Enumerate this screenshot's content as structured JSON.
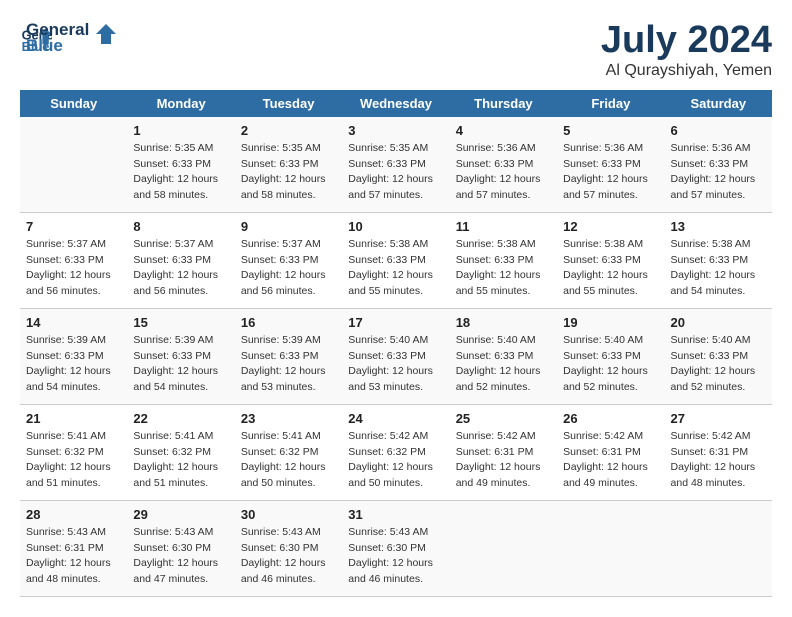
{
  "header": {
    "logo_line1": "General",
    "logo_line2": "Blue",
    "month_year": "July 2024",
    "location": "Al Qurayshiyah, Yemen"
  },
  "weekdays": [
    "Sunday",
    "Monday",
    "Tuesday",
    "Wednesday",
    "Thursday",
    "Friday",
    "Saturday"
  ],
  "weeks": [
    [
      {
        "day": "",
        "sunrise": "",
        "sunset": "",
        "daylight": ""
      },
      {
        "day": "1",
        "sunrise": "Sunrise: 5:35 AM",
        "sunset": "Sunset: 6:33 PM",
        "daylight": "Daylight: 12 hours and 58 minutes."
      },
      {
        "day": "2",
        "sunrise": "Sunrise: 5:35 AM",
        "sunset": "Sunset: 6:33 PM",
        "daylight": "Daylight: 12 hours and 58 minutes."
      },
      {
        "day": "3",
        "sunrise": "Sunrise: 5:35 AM",
        "sunset": "Sunset: 6:33 PM",
        "daylight": "Daylight: 12 hours and 57 minutes."
      },
      {
        "day": "4",
        "sunrise": "Sunrise: 5:36 AM",
        "sunset": "Sunset: 6:33 PM",
        "daylight": "Daylight: 12 hours and 57 minutes."
      },
      {
        "day": "5",
        "sunrise": "Sunrise: 5:36 AM",
        "sunset": "Sunset: 6:33 PM",
        "daylight": "Daylight: 12 hours and 57 minutes."
      },
      {
        "day": "6",
        "sunrise": "Sunrise: 5:36 AM",
        "sunset": "Sunset: 6:33 PM",
        "daylight": "Daylight: 12 hours and 57 minutes."
      }
    ],
    [
      {
        "day": "7",
        "sunrise": "Sunrise: 5:37 AM",
        "sunset": "Sunset: 6:33 PM",
        "daylight": "Daylight: 12 hours and 56 minutes."
      },
      {
        "day": "8",
        "sunrise": "Sunrise: 5:37 AM",
        "sunset": "Sunset: 6:33 PM",
        "daylight": "Daylight: 12 hours and 56 minutes."
      },
      {
        "day": "9",
        "sunrise": "Sunrise: 5:37 AM",
        "sunset": "Sunset: 6:33 PM",
        "daylight": "Daylight: 12 hours and 56 minutes."
      },
      {
        "day": "10",
        "sunrise": "Sunrise: 5:38 AM",
        "sunset": "Sunset: 6:33 PM",
        "daylight": "Daylight: 12 hours and 55 minutes."
      },
      {
        "day": "11",
        "sunrise": "Sunrise: 5:38 AM",
        "sunset": "Sunset: 6:33 PM",
        "daylight": "Daylight: 12 hours and 55 minutes."
      },
      {
        "day": "12",
        "sunrise": "Sunrise: 5:38 AM",
        "sunset": "Sunset: 6:33 PM",
        "daylight": "Daylight: 12 hours and 55 minutes."
      },
      {
        "day": "13",
        "sunrise": "Sunrise: 5:38 AM",
        "sunset": "Sunset: 6:33 PM",
        "daylight": "Daylight: 12 hours and 54 minutes."
      }
    ],
    [
      {
        "day": "14",
        "sunrise": "Sunrise: 5:39 AM",
        "sunset": "Sunset: 6:33 PM",
        "daylight": "Daylight: 12 hours and 54 minutes."
      },
      {
        "day": "15",
        "sunrise": "Sunrise: 5:39 AM",
        "sunset": "Sunset: 6:33 PM",
        "daylight": "Daylight: 12 hours and 54 minutes."
      },
      {
        "day": "16",
        "sunrise": "Sunrise: 5:39 AM",
        "sunset": "Sunset: 6:33 PM",
        "daylight": "Daylight: 12 hours and 53 minutes."
      },
      {
        "day": "17",
        "sunrise": "Sunrise: 5:40 AM",
        "sunset": "Sunset: 6:33 PM",
        "daylight": "Daylight: 12 hours and 53 minutes."
      },
      {
        "day": "18",
        "sunrise": "Sunrise: 5:40 AM",
        "sunset": "Sunset: 6:33 PM",
        "daylight": "Daylight: 12 hours and 52 minutes."
      },
      {
        "day": "19",
        "sunrise": "Sunrise: 5:40 AM",
        "sunset": "Sunset: 6:33 PM",
        "daylight": "Daylight: 12 hours and 52 minutes."
      },
      {
        "day": "20",
        "sunrise": "Sunrise: 5:40 AM",
        "sunset": "Sunset: 6:33 PM",
        "daylight": "Daylight: 12 hours and 52 minutes."
      }
    ],
    [
      {
        "day": "21",
        "sunrise": "Sunrise: 5:41 AM",
        "sunset": "Sunset: 6:32 PM",
        "daylight": "Daylight: 12 hours and 51 minutes."
      },
      {
        "day": "22",
        "sunrise": "Sunrise: 5:41 AM",
        "sunset": "Sunset: 6:32 PM",
        "daylight": "Daylight: 12 hours and 51 minutes."
      },
      {
        "day": "23",
        "sunrise": "Sunrise: 5:41 AM",
        "sunset": "Sunset: 6:32 PM",
        "daylight": "Daylight: 12 hours and 50 minutes."
      },
      {
        "day": "24",
        "sunrise": "Sunrise: 5:42 AM",
        "sunset": "Sunset: 6:32 PM",
        "daylight": "Daylight: 12 hours and 50 minutes."
      },
      {
        "day": "25",
        "sunrise": "Sunrise: 5:42 AM",
        "sunset": "Sunset: 6:31 PM",
        "daylight": "Daylight: 12 hours and 49 minutes."
      },
      {
        "day": "26",
        "sunrise": "Sunrise: 5:42 AM",
        "sunset": "Sunset: 6:31 PM",
        "daylight": "Daylight: 12 hours and 49 minutes."
      },
      {
        "day": "27",
        "sunrise": "Sunrise: 5:42 AM",
        "sunset": "Sunset: 6:31 PM",
        "daylight": "Daylight: 12 hours and 48 minutes."
      }
    ],
    [
      {
        "day": "28",
        "sunrise": "Sunrise: 5:43 AM",
        "sunset": "Sunset: 6:31 PM",
        "daylight": "Daylight: 12 hours and 48 minutes."
      },
      {
        "day": "29",
        "sunrise": "Sunrise: 5:43 AM",
        "sunset": "Sunset: 6:30 PM",
        "daylight": "Daylight: 12 hours and 47 minutes."
      },
      {
        "day": "30",
        "sunrise": "Sunrise: 5:43 AM",
        "sunset": "Sunset: 6:30 PM",
        "daylight": "Daylight: 12 hours and 46 minutes."
      },
      {
        "day": "31",
        "sunrise": "Sunrise: 5:43 AM",
        "sunset": "Sunset: 6:30 PM",
        "daylight": "Daylight: 12 hours and 46 minutes."
      },
      {
        "day": "",
        "sunrise": "",
        "sunset": "",
        "daylight": ""
      },
      {
        "day": "",
        "sunrise": "",
        "sunset": "",
        "daylight": ""
      },
      {
        "day": "",
        "sunrise": "",
        "sunset": "",
        "daylight": ""
      }
    ]
  ]
}
